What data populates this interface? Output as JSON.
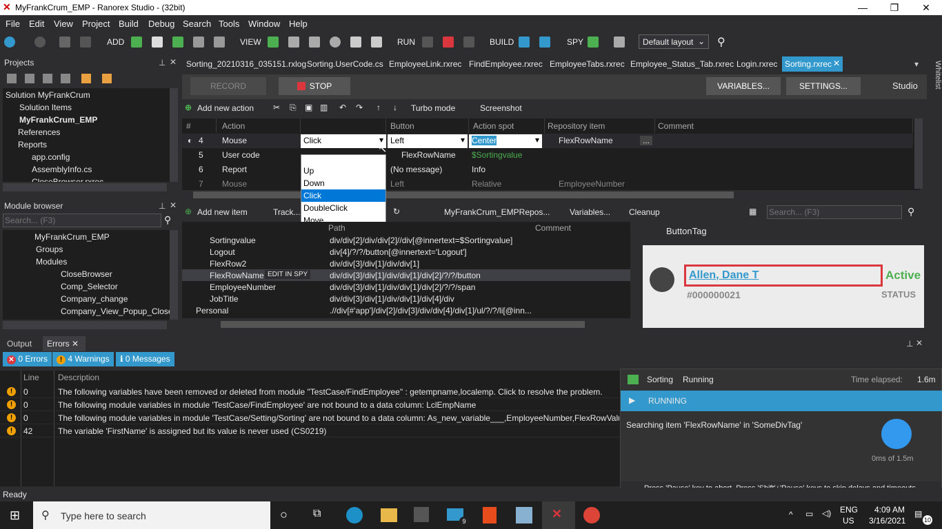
{
  "window": {
    "title": "MyFrankCrum_EMP - Ranorex Studio - (32bit)"
  },
  "menu": [
    "File",
    "Edit",
    "View",
    "Project",
    "Build",
    "Debug",
    "Search",
    "Tools",
    "Window",
    "Help"
  ],
  "toolbar": {
    "add": "ADD",
    "view": "VIEW",
    "run": "RUN",
    "build": "BUILD",
    "spy": "SPY",
    "layout": "Default layout"
  },
  "projects": {
    "title": "Projects",
    "items": [
      "Solution MyFrankCrum",
      "Solution Items",
      "MyFrankCrum_EMP",
      "References",
      "Reports",
      "app.config",
      "AssemblyInfo.cs",
      "CloseBrowser.rxrec"
    ]
  },
  "module_browser": {
    "title": "Module browser",
    "search_placeholder": "Search... (F3)",
    "items": [
      "MyFrankCrum_EMP",
      "Groups",
      "Modules",
      "CloseBrowser",
      "Comp_Selector",
      "Company_change",
      "Company_View_Popup_Close"
    ]
  },
  "tabs": [
    "Sorting_20210316_035151.rxlog",
    "Sorting.UserCode.cs",
    "EmployeeLink.rxrec",
    "FindEmployee.rxrec",
    "EmployeeTabs.rxrec",
    "Employee_Status_Tab.rxrec",
    "Login.rxrec",
    "Sorting.rxrec"
  ],
  "side_tab": "Whitelist",
  "recorder": {
    "record": "RECORD",
    "stop": "STOP",
    "variables": "VARIABLES...",
    "settings": "SETTINGS...",
    "studio": "Studio"
  },
  "actions_bar": {
    "add_action": "Add new action",
    "turbo": "Turbo mode",
    "screenshot": "Screenshot"
  },
  "grid": {
    "headers": [
      "#",
      "Action",
      "",
      "Button",
      "Action spot",
      "Repository item",
      "Comment"
    ],
    "rows": [
      {
        "num": "4",
        "action": "Mouse",
        "type": "Click",
        "button": "Left",
        "spot": "Center",
        "repo": "FlexRowName",
        "more": "..."
      },
      {
        "num": "5",
        "action": "User code",
        "type": "",
        "button": "FlexRowName",
        "spot": "$Sortingvalue",
        "repo": ""
      },
      {
        "num": "6",
        "action": "Report",
        "type": "",
        "button": "(No message)",
        "spot": "Info",
        "repo": ""
      },
      {
        "num": "7",
        "action": "Mouse",
        "type": "",
        "button": "Left",
        "spot": "Relative",
        "repo": "EmployeeNumber"
      }
    ]
  },
  "dropdown": [
    "Up",
    "Down",
    "Click",
    "DoubleClick",
    "Move"
  ],
  "repo_bar": {
    "add_item": "Add new item",
    "track": "Track...",
    "repo": "MyFrankCrum_EMPRepos...",
    "variables": "Variables...",
    "cleanup": "Cleanup",
    "search": "Search... (F3)"
  },
  "repo": {
    "headers": [
      "Path",
      "Comment"
    ],
    "rows": [
      {
        "name": "Sortingvalue",
        "path": "div/div[2]/div/div[2]//div[@innertext=$Sortingvalue]"
      },
      {
        "name": "Logout",
        "path": "div[4]/?/?/button[@innertext='Logout']"
      },
      {
        "name": "FlexRow2",
        "path": "div/div[3]/div[1]/div/div[1]"
      },
      {
        "name": "FlexRowName",
        "path": "div/div[3]/div[1]/div/div[1]/div[2]/?/?/button",
        "tag": "EDIT IN SPY"
      },
      {
        "name": "EmployeeNumber",
        "path": "div/div[3]/div[1]/div/div[1]/div[2]/?/?/span"
      },
      {
        "name": "JobTitle",
        "path": "div/div[3]/div[1]/div/div[1]/div[4]/div"
      },
      {
        "name": "Personal",
        "path": ".//div[#'app']/div[2]/div[3]/div/div[4]/div[1]/ul/?/?/li[@inn..."
      }
    ]
  },
  "preview": {
    "title": "ButtonTag",
    "name": "Allen, Dane T",
    "id": "#000000021",
    "active": "Active",
    "status": "STATUS"
  },
  "bottom_tabs": {
    "output": "Output",
    "errors": "Errors"
  },
  "badges": {
    "errors": "0 Errors",
    "warnings": "4 Warnings",
    "messages": "0 Messages"
  },
  "errors": {
    "headers": [
      "",
      "Line",
      "Description"
    ],
    "rows": [
      {
        "line": "0",
        "desc": "The following variables have been removed or deleted from module \"TestCase/FindEmployee\" : getempname,localemp. Click to resolve the problem."
      },
      {
        "line": "0",
        "desc": "The following module variables in module 'TestCase/FindEmployee' are not bound to a data column: LclEmpName"
      },
      {
        "line": "0",
        "desc": "The following module variables in module 'TestCase/Setting/Sorting' are not bound to a data column: As_new_variable___,EmployeeNumber,FlexRowValue,"
      },
      {
        "line": "42",
        "desc": "The variable 'FirstName' is assigned but its value is never used (CS0219)"
      }
    ]
  },
  "run_popup": {
    "name": "Sorting",
    "state": "Running",
    "elapsed_label": "Time elapsed:",
    "elapsed": "1.6m",
    "banner": "RUNNING",
    "message": "Searching item 'FlexRowName' in 'SomeDivTag'",
    "timer": "0ms of 1.5m",
    "hint": "Press 'Pause' key to abort. Press 'Shift'+'Pause' keys to skip delays and timeouts."
  },
  "statusbar": "Ready",
  "taskbar": {
    "search": "Type here to search",
    "lang1": "ENG",
    "lang2": "US",
    "time": "4:09 AM",
    "date": "3/16/2021",
    "notif": "10",
    "mail_badge": "9"
  }
}
